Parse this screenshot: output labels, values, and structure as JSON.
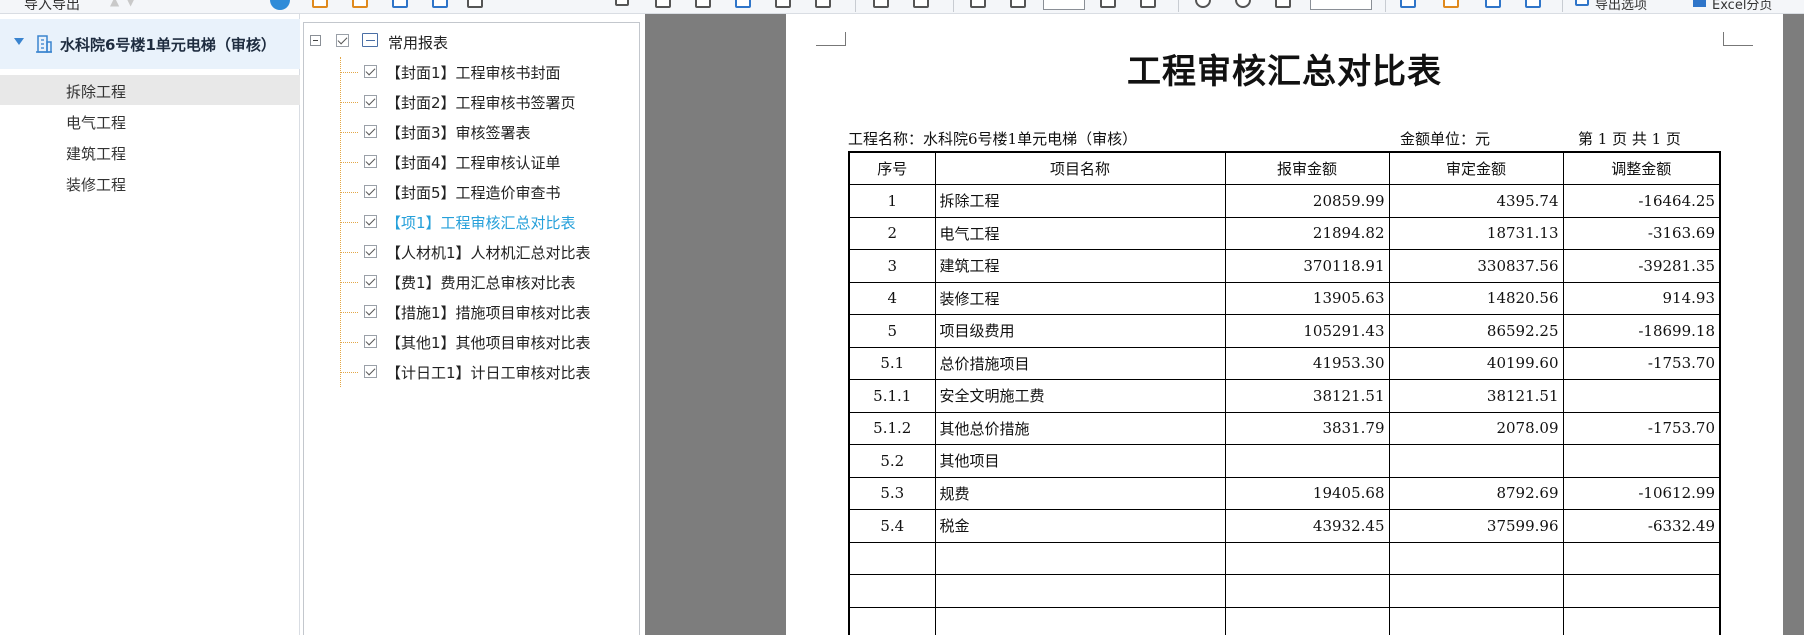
{
  "toolbar": {
    "nav_title": "导入导出",
    "export_label": "导出选项",
    "excel_label": "Excel分页"
  },
  "project_tree": {
    "root_label": "水科院6号楼1单元电梯（审核）",
    "items": [
      {
        "label": "拆除工程",
        "selected": true
      },
      {
        "label": "电气工程",
        "selected": false
      },
      {
        "label": "建筑工程",
        "selected": false
      },
      {
        "label": "装修工程",
        "selected": false
      }
    ]
  },
  "report_tree": {
    "group_label": "常用报表",
    "items": [
      {
        "label": "【封面1】工程审核书封面",
        "active": false
      },
      {
        "label": "【封面2】工程审核书签署页",
        "active": false
      },
      {
        "label": "【封面3】审核签署表",
        "active": false
      },
      {
        "label": "【封面4】工程审核认证单",
        "active": false
      },
      {
        "label": "【封面5】工程造价审查书",
        "active": false
      },
      {
        "label": "【项1】工程审核汇总对比表",
        "active": true
      },
      {
        "label": "【人材机1】人材机汇总对比表",
        "active": false
      },
      {
        "label": "【费1】费用汇总审核对比表",
        "active": false
      },
      {
        "label": "【措施1】措施项目审核对比表",
        "active": false
      },
      {
        "label": "【其他1】其他项目审核对比表",
        "active": false
      },
      {
        "label": "【计日工1】计日工审核对比表",
        "active": false
      }
    ]
  },
  "report": {
    "title": "工程审核汇总对比表",
    "project_name": "工程名称：水科院6号楼1单元电梯（审核）",
    "unit": "金额单位：元",
    "page": "第 1 页  共 1 页",
    "columns": [
      "序号",
      "项目名称",
      "报审金额",
      "审定金额",
      "调整金额"
    ],
    "rows": [
      [
        "1",
        "拆除工程",
        "20859.99",
        "4395.74",
        "-16464.25"
      ],
      [
        "2",
        "电气工程",
        "21894.82",
        "18731.13",
        "-3163.69"
      ],
      [
        "3",
        "建筑工程",
        "370118.91",
        "330837.56",
        "-39281.35"
      ],
      [
        "4",
        "装修工程",
        "13905.63",
        "14820.56",
        "914.93"
      ],
      [
        "5",
        "项目级费用",
        "105291.43",
        "86592.25",
        "-18699.18"
      ],
      [
        "5.1",
        "总价措施项目",
        "41953.30",
        "40199.60",
        "-1753.70"
      ],
      [
        "5.1.1",
        "安全文明施工费",
        "38121.51",
        "38121.51",
        ""
      ],
      [
        "5.1.2",
        "其他总价措施",
        "3831.79",
        "2078.09",
        "-1753.70"
      ],
      [
        "5.2",
        "其他项目",
        "",
        "",
        ""
      ],
      [
        "5.3",
        "规费",
        "19405.68",
        "8792.69",
        "-10612.99"
      ],
      [
        "5.4",
        "税金",
        "43932.45",
        "37599.96",
        "-6332.49"
      ],
      [
        "",
        "",
        "",
        "",
        ""
      ],
      [
        "",
        "",
        "",
        "",
        ""
      ],
      [
        "",
        "",
        "",
        "",
        ""
      ]
    ]
  }
}
